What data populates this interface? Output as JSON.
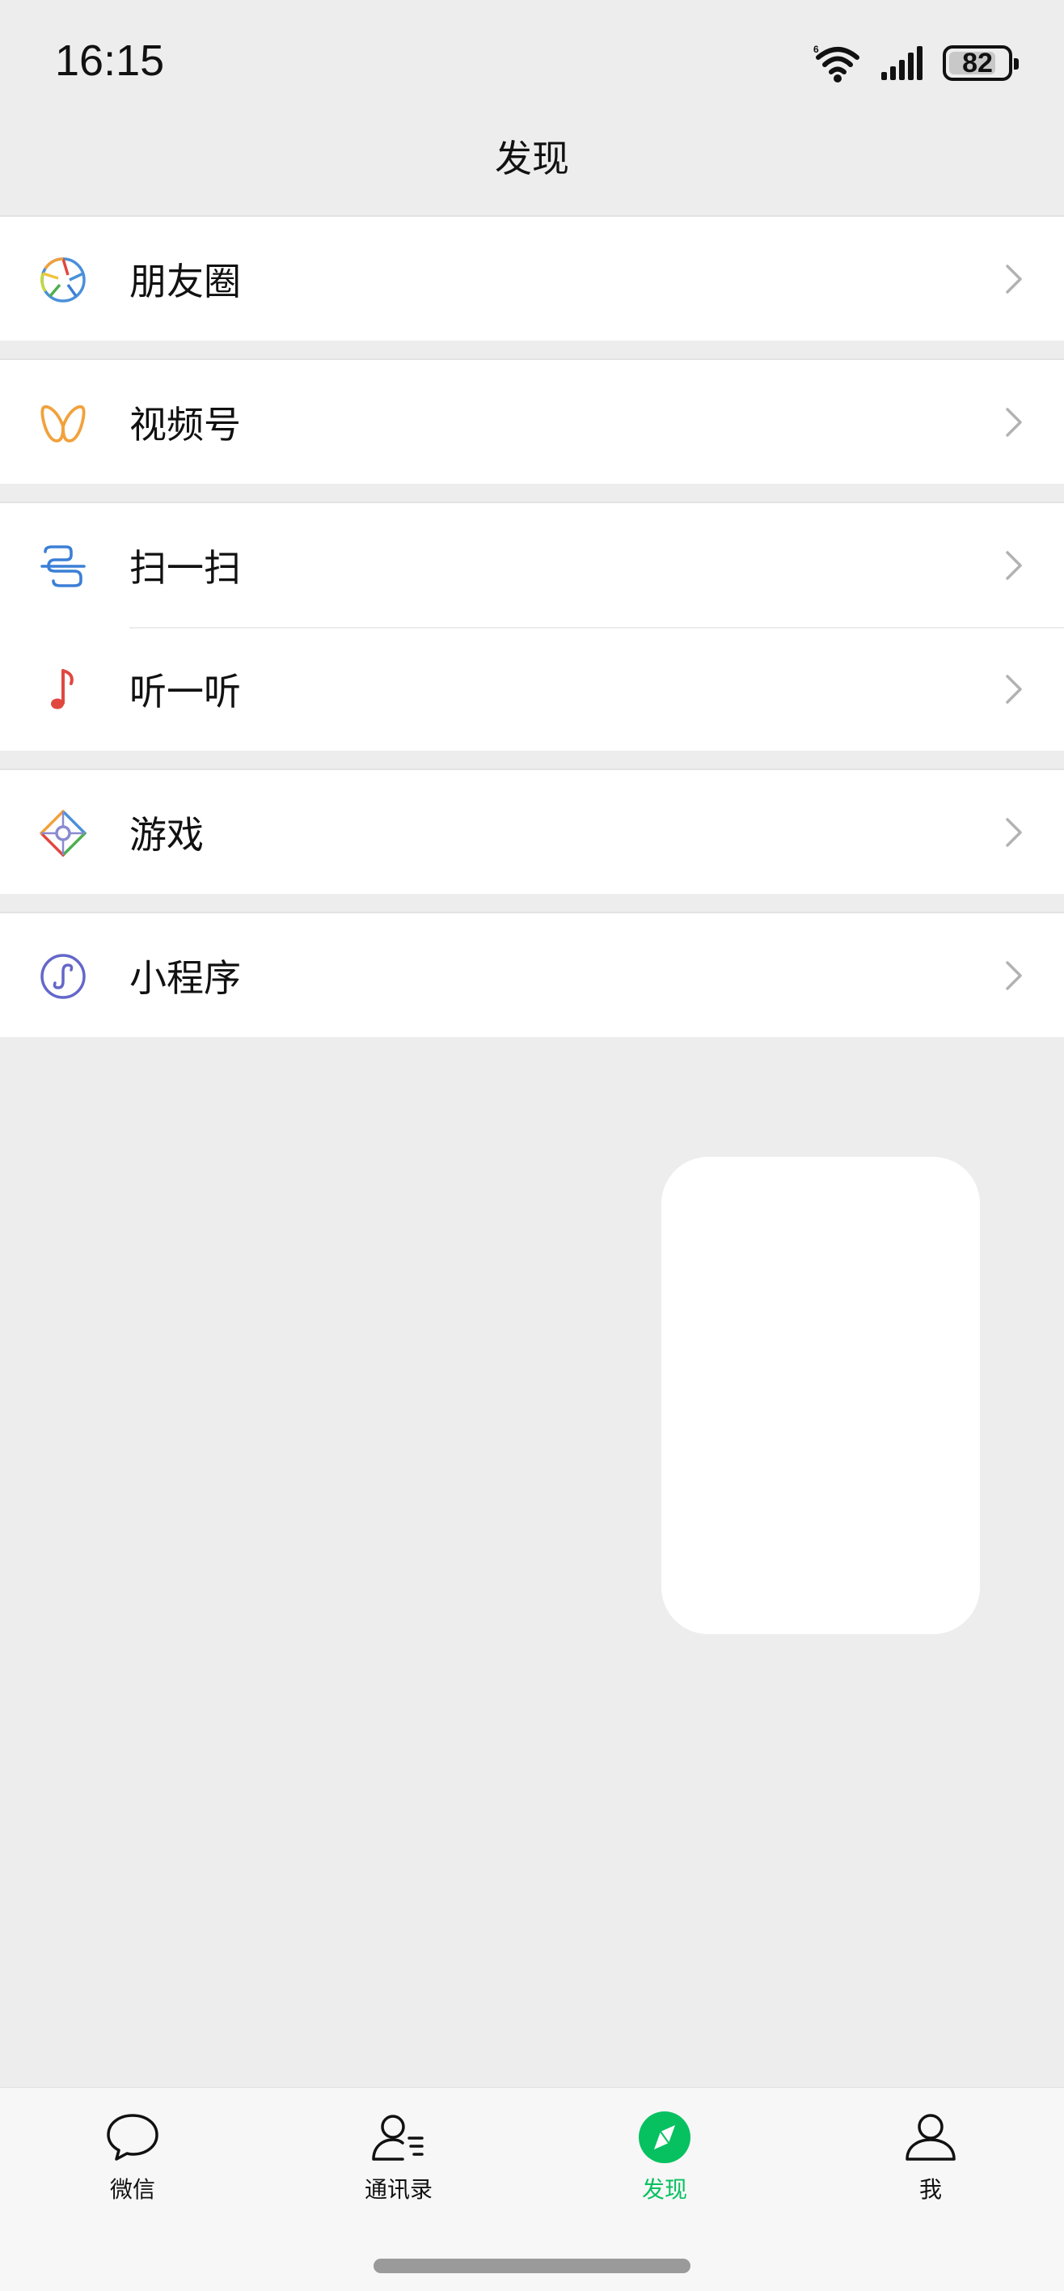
{
  "status_bar": {
    "time": "16:15",
    "battery_percent": "82",
    "battery_level": 0.82,
    "icons": [
      "wifi-icon",
      "signal-icon",
      "battery-icon"
    ]
  },
  "header": {
    "title": "发现"
  },
  "menu": {
    "groups": [
      {
        "items": [
          {
            "label": "朋友圈",
            "icon": "moments-aperture-icon"
          }
        ]
      },
      {
        "items": [
          {
            "label": "视频号",
            "icon": "channels-icon"
          }
        ]
      },
      {
        "items": [
          {
            "label": "扫一扫",
            "icon": "scan-icon"
          },
          {
            "label": "听一听",
            "icon": "music-note-icon"
          }
        ]
      },
      {
        "items": [
          {
            "label": "游戏",
            "icon": "game-diamond-icon"
          }
        ]
      },
      {
        "items": [
          {
            "label": "小程序",
            "icon": "mini-program-icon"
          }
        ]
      }
    ]
  },
  "tab_bar": {
    "tabs": [
      {
        "label": "微信",
        "icon": "chat-bubble-icon",
        "active": false
      },
      {
        "label": "通讯录",
        "icon": "contacts-icon",
        "active": false
      },
      {
        "label": "发现",
        "icon": "discover-compass-icon",
        "active": true
      },
      {
        "label": "我",
        "icon": "person-icon",
        "active": false
      }
    ]
  },
  "colors": {
    "background": "#ededed",
    "accent": "#07c160",
    "moments": "#4a90d9",
    "channels": "#f2a13c",
    "scan": "#3b7fd6",
    "music": "#e0483f",
    "mini_program": "#6467c9"
  }
}
